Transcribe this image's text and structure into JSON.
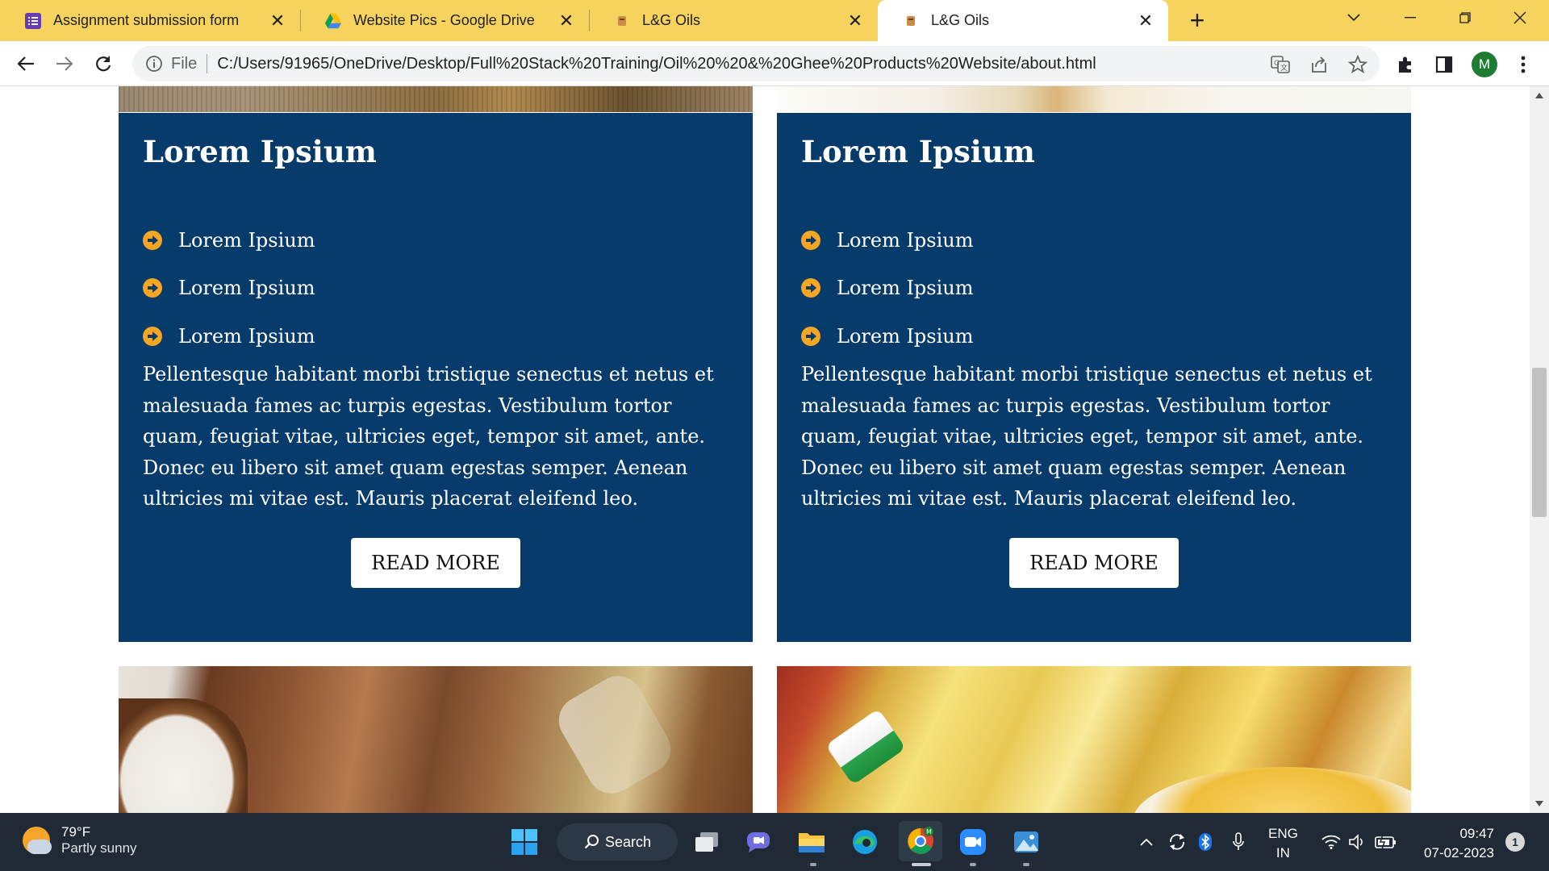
{
  "browser": {
    "tabs": [
      {
        "title": "Assignment submission form",
        "favicon": "forms-icon",
        "active": false
      },
      {
        "title": "Website Pics - Google Drive",
        "favicon": "google-drive-icon",
        "active": false
      },
      {
        "title": "L&G Oils",
        "favicon": "site-favicon-icon",
        "active": false
      },
      {
        "title": "L&G Oils",
        "favicon": "site-favicon-icon",
        "active": true
      }
    ],
    "address": {
      "scheme": "File",
      "url": "C:/Users/91965/OneDrive/Desktop/Full%20Stack%20Training/Oil%20%20&%20Ghee%20Products%20Website/about.html"
    },
    "profile_initial": "M",
    "tabstrip_color": "#f6d35c"
  },
  "page": {
    "card_color": "#063b6b",
    "bullet_color": "#f5a623",
    "cards": [
      {
        "heading": "Lorem Ipsium",
        "items": [
          "Lorem Ipsium",
          "Lorem Ipsium",
          "Lorem Ipsium"
        ],
        "text": "Pellentesque habitant morbi tristique senectus et netus et malesuada fames ac turpis egestas. Vestibulum tortor quam, feugiat vitae, ultricies eget, tempor sit amet, ante. Donec eu libero sit amet quam egestas semper. Aenean ultricies mi vitae est. Mauris placerat eleifend leo.",
        "button": "READ MORE"
      },
      {
        "heading": "Lorem Ipsium",
        "items": [
          "Lorem Ipsium",
          "Lorem Ipsium",
          "Lorem Ipsium"
        ],
        "text": "Pellentesque habitant morbi tristique senectus et netus et malesuada fames ac turpis egestas. Vestibulum tortor quam, feugiat vitae, ultricies eget, tempor sit amet, ante. Donec eu libero sit amet quam egestas semper. Aenean ultricies mi vitae est. Mauris placerat eleifend leo.",
        "button": "READ MORE"
      }
    ]
  },
  "taskbar": {
    "weather": {
      "temp": "79°F",
      "desc": "Partly sunny"
    },
    "search_label": "Search",
    "apps": [
      "start-icon",
      "search-icon",
      "task-view-icon",
      "chat-icon",
      "file-explorer-icon",
      "edge-icon",
      "chrome-icon",
      "zoom-icon",
      "photos-icon"
    ],
    "language": {
      "line1": "ENG",
      "line2": "IN"
    },
    "clock": {
      "time": "09:47",
      "date": "07-02-2023"
    },
    "notification_count": "1"
  }
}
